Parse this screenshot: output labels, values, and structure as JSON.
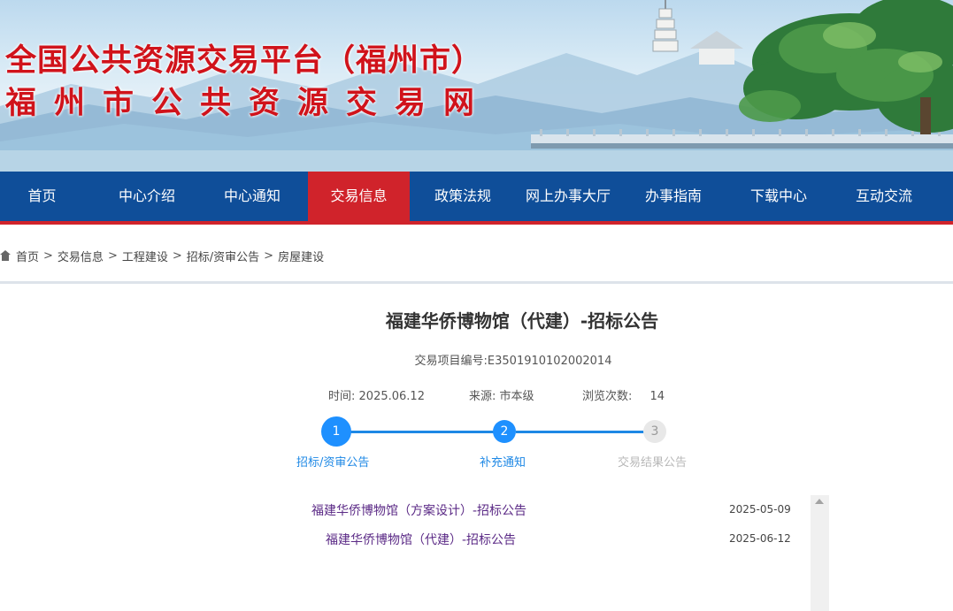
{
  "banner": {
    "title_line1": "全国公共资源交易平台（福州市）",
    "title_line2": "福州市公共资源交易网"
  },
  "nav": {
    "items": [
      "首页",
      "中心介绍",
      "中心通知",
      "交易信息",
      "政策法规",
      "网上办事大厅",
      "办事指南",
      "下载中心",
      "互动交流"
    ],
    "active": "交易信息"
  },
  "breadcrumb": [
    "首页",
    "交易信息",
    "工程建设",
    "招标/资审公告",
    "房屋建设"
  ],
  "article": {
    "title": "福建华侨博物馆（代建）-招标公告",
    "code": "交易项目编号:E3501910102002014",
    "time_label": "时间:",
    "time_value": "2025.06.12",
    "source_label": "来源:",
    "source_value": "市本级",
    "views_label": "浏览次数:",
    "views_value": "14"
  },
  "steps": [
    {
      "num": "1",
      "label": "招标/资审公告",
      "done": true
    },
    {
      "num": "2",
      "label": "补充通知",
      "done": true
    },
    {
      "num": "3",
      "label": "交易结果公告",
      "done": false
    }
  ],
  "related": [
    {
      "title": "福建华侨博物馆（方案设计）-招标公告",
      "date": "2025-05-09"
    },
    {
      "title": "福建华侨博物馆（代建）-招标公告",
      "date": "2025-06-12"
    }
  ],
  "colors": {
    "nav_bg": "#0f4e99",
    "nav_active": "#d0232b",
    "banner_title": "#d0131b",
    "step_active": "#1e90ff",
    "link": "#5b2a86"
  }
}
